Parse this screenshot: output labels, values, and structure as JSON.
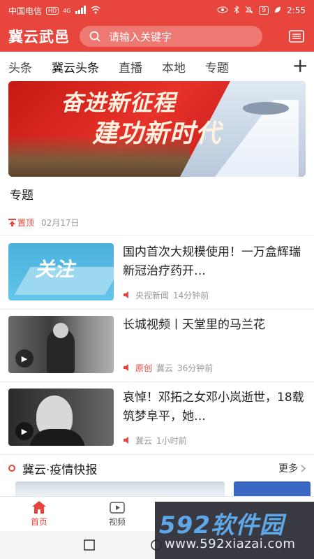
{
  "status_bar": {
    "carrier": "中国电信",
    "hd": "HD",
    "network": "4G",
    "battery": "9",
    "time": "2:55"
  },
  "header": {
    "app_title": "冀云武邑",
    "search_placeholder": "请输入关键字"
  },
  "tabs": [
    "头条",
    "冀云头条",
    "直播",
    "本地",
    "专题"
  ],
  "banner": {
    "line1": "奋进新征程",
    "line2": "建功新时代"
  },
  "section_label": "专题",
  "pinned": {
    "label": "置顶",
    "date": "02月17日"
  },
  "news": [
    {
      "title": "国内首次大规模使用！一万盒辉瑞新冠治疗药开…",
      "thumb_text": "关注",
      "source": "央视新闻",
      "time": "14分钟前",
      "original": ""
    },
    {
      "title": "长城视频丨天堂里的马兰花",
      "original": "原创",
      "source": "冀云",
      "time": "36分钟前"
    },
    {
      "title": "哀悼！邓拓之女邓小岚逝世，18载筑梦阜平，她…",
      "original": "",
      "source": "冀云",
      "time": "1小时前"
    }
  ],
  "epidemic": {
    "title": "冀云·疫情快报",
    "more": "更多"
  },
  "bottom_nav": [
    {
      "label": "首页",
      "icon": "home-icon",
      "active": true
    },
    {
      "label": "视频",
      "icon": "video-icon",
      "active": false
    }
  ],
  "watermark": {
    "brand": "592软件园",
    "url": "www.592xiazai.com"
  },
  "colors": {
    "accent": "#e8453c"
  }
}
